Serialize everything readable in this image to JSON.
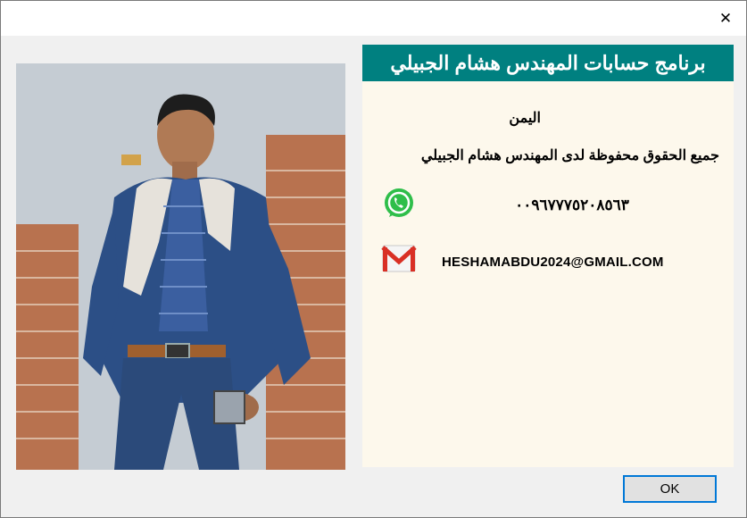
{
  "window": {
    "close_glyph": "✕"
  },
  "panel": {
    "title": "برنامج حسابات المهندس هشام الجبيلي",
    "country": "اليمن",
    "rights": "جميع الحقوق محفوظة لدى المهندس هشام الجبيلي",
    "phone": "٠٠٩٦٧٧٧٥٢٠٨٥٦٣",
    "email": "HESHAMABDU2024@GMAIL.COM"
  },
  "icons": {
    "whatsapp": "whatsapp-icon",
    "gmail": "gmail-icon",
    "close": "close-icon"
  },
  "colors": {
    "header": "#008080",
    "panel_bg": "#fdf8ec",
    "ok_border": "#0078d7"
  },
  "buttons": {
    "ok_label": "OK"
  }
}
